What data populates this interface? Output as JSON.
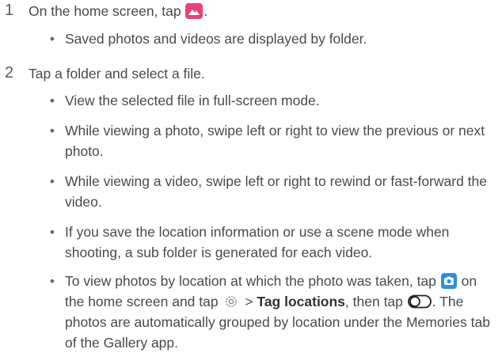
{
  "steps": [
    {
      "number": "1",
      "before_icon": "On the home screen, tap ",
      "icon": "gallery-icon",
      "after_icon": ".",
      "bullets": [
        "Saved photos and videos are displayed by folder."
      ]
    },
    {
      "number": "2",
      "text": "Tap a folder and select a file.",
      "bullets": [
        "View the selected file in full-screen mode.",
        "While viewing a photo, swipe left or right to view the previous or next photo.",
        "While viewing a video, swipe left or right to rewind or fast-forward the video.",
        "If you save the location information or use a scene mode when shooting, a sub folder is generated for each video."
      ],
      "last_bullet": {
        "part1": "To view photos by location at which the photo was taken, tap ",
        "icon1": "camera-icon",
        "part2": " on the home screen and tap ",
        "icon2": "settings-gear-icon",
        "part3": " > ",
        "bold": "Tag locations",
        "part4": ", then tap ",
        "icon3": "toggle-switch-icon",
        "part5": ". The photos are automatically grouped by location under the Memories tab of the Gallery app."
      }
    }
  ],
  "colors": {
    "text": "#4a4a4a",
    "gallery_icon": "#e9427a",
    "camera_icon": "#2b8fe0"
  }
}
